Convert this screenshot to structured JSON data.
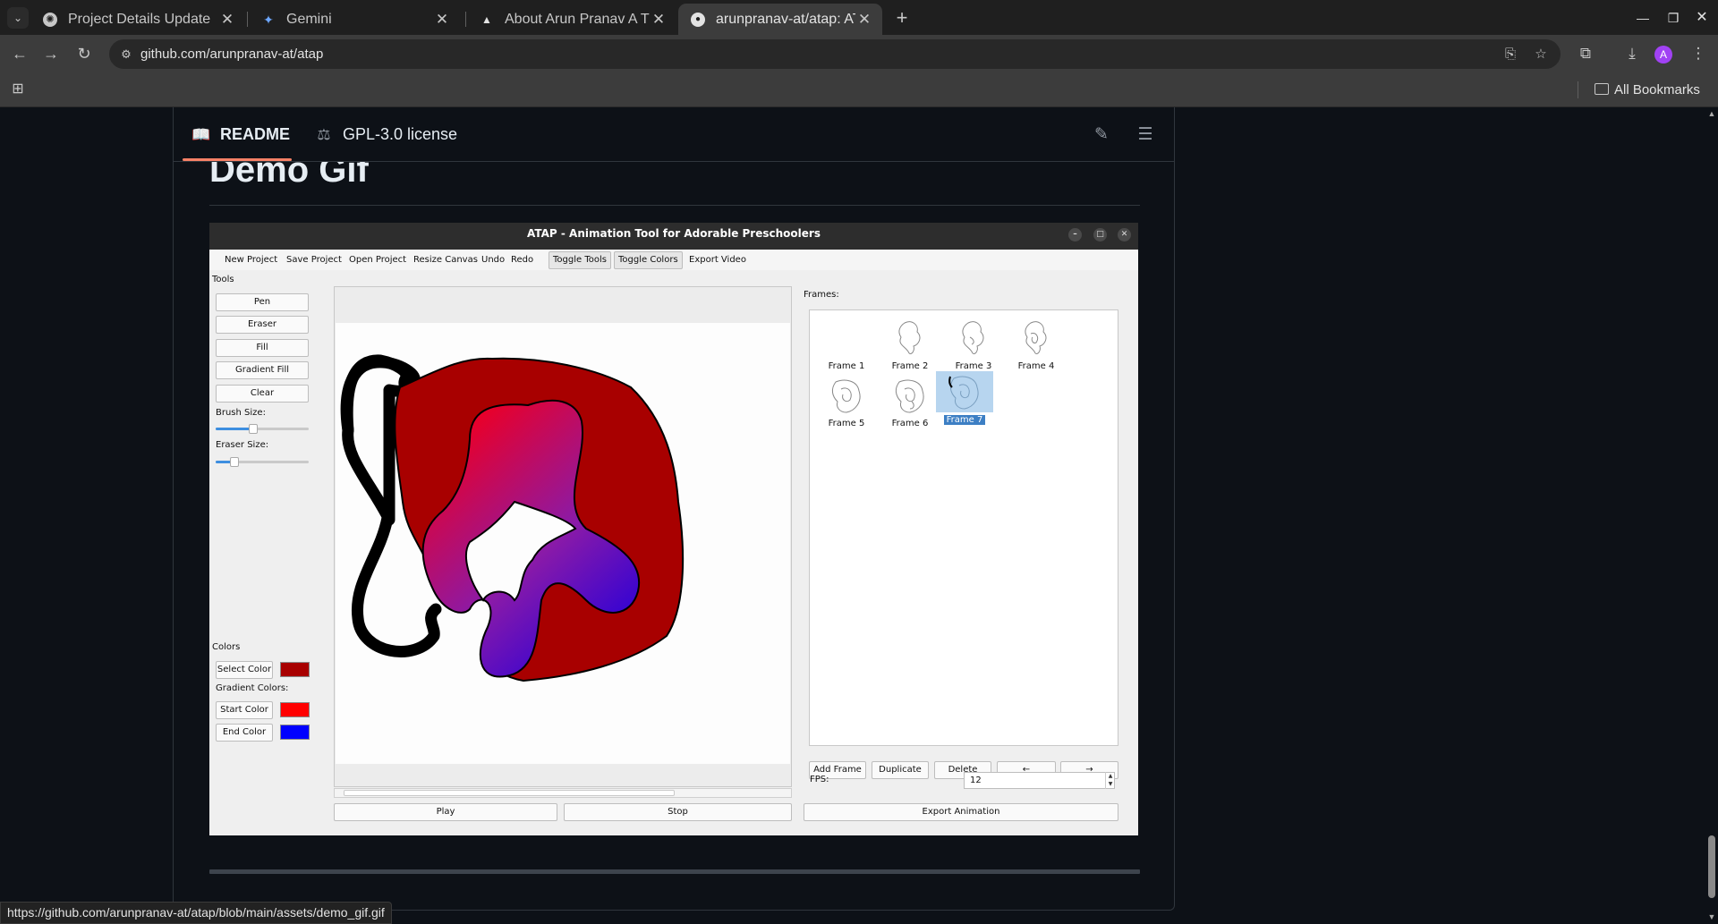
{
  "browser": {
    "tabs": [
      {
        "title": "Project Details Update",
        "icon": "chatgpt-icon",
        "active": false
      },
      {
        "title": "Gemini",
        "icon": "gemini-sparkle-icon",
        "active": false
      },
      {
        "title": "About Arun Pranav A T",
        "icon": "vercel-triangle-icon",
        "active": false
      },
      {
        "title": "arunpranav-at/atap: ATA",
        "icon": "github-icon",
        "active": true
      }
    ],
    "url": "github.com/arunpranav-at/atap",
    "bookmarks_all": "All Bookmarks",
    "avatar_letter": "A",
    "status_url": "https://github.com/arunpranav-at/atap/blob/main/assets/demo_gif.gif"
  },
  "readme": {
    "tabs": [
      {
        "label": "README",
        "icon": "book-icon",
        "active": true
      },
      {
        "label": "GPL-3.0 license",
        "icon": "law-scale-icon",
        "active": false
      }
    ],
    "heading": "Demo Gif"
  },
  "app": {
    "title": "ATAP - Animation Tool for Adorable Preschoolers",
    "menu": [
      {
        "label": "New Project",
        "toggled": false
      },
      {
        "label": "Save Project",
        "toggled": false
      },
      {
        "label": "Open Project",
        "toggled": false
      },
      {
        "label": "Resize Canvas",
        "toggled": false
      },
      {
        "label": "Undo",
        "toggled": false
      },
      {
        "label": "Redo",
        "toggled": false
      },
      {
        "label": "Toggle Tools",
        "toggled": true
      },
      {
        "label": "Toggle Colors",
        "toggled": true
      },
      {
        "label": "Export Video",
        "toggled": false
      }
    ],
    "tools_label": "Tools",
    "tools": [
      "Pen",
      "Eraser",
      "Fill",
      "Gradient Fill",
      "Clear"
    ],
    "brush_size_label": "Brush Size:",
    "brush_size_level": 0.4,
    "eraser_size_label": "Eraser Size:",
    "eraser_size_level": 0.2,
    "colors_label": "Colors",
    "select_color_label": "Select Color",
    "select_color": "#a80000",
    "gradient_colors_label": "Gradient Colors:",
    "start_color_label": "Start Color",
    "start_color": "#ff0000",
    "end_color_label": "End Color",
    "end_color": "#0000ff",
    "frames_label": "Frames:",
    "frames": [
      "Frame 1",
      "Frame 2",
      "Frame 3",
      "Frame 4",
      "Frame 5",
      "Frame 6",
      "Frame 7"
    ],
    "selected_frame": 7,
    "frame_buttons": {
      "add": "Add Frame",
      "duplicate": "Duplicate",
      "delete": "Delete",
      "prev": "←",
      "next": "→"
    },
    "fps_label": "FPS:",
    "fps_value": "12",
    "play_label": "Play",
    "stop_label": "Stop",
    "export_label": "Export Animation"
  }
}
